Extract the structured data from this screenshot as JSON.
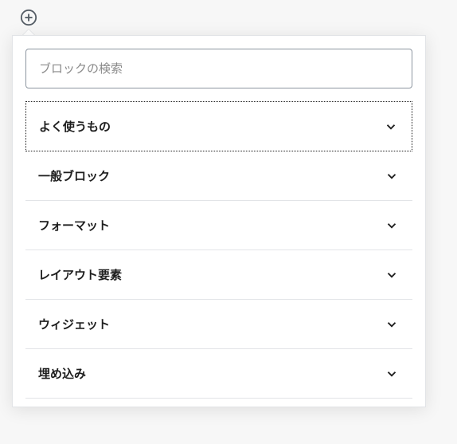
{
  "search": {
    "placeholder": "ブロックの検索"
  },
  "categories": [
    {
      "label": "よく使うもの",
      "selected": true
    },
    {
      "label": "一般ブロック",
      "selected": false
    },
    {
      "label": "フォーマット",
      "selected": false
    },
    {
      "label": "レイアウト要素",
      "selected": false
    },
    {
      "label": "ウィジェット",
      "selected": false
    },
    {
      "label": "埋め込み",
      "selected": false
    }
  ]
}
